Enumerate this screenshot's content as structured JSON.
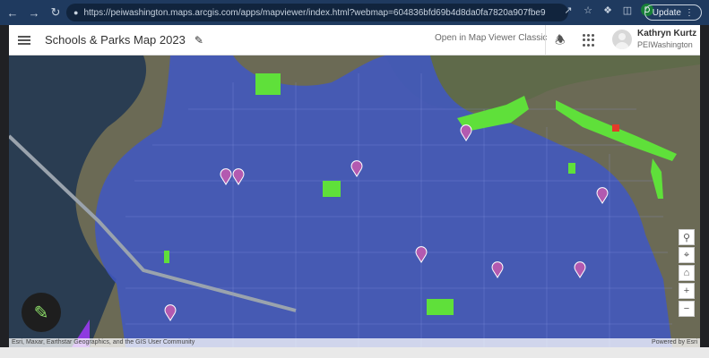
{
  "browser": {
    "url": "https://peiwashington.maps.arcgis.com/apps/mapviewer/index.html?webmap=604836bfd69b4d8da0fa7820a907fbe9",
    "profile_initial": "D",
    "update_label": "Update"
  },
  "header": {
    "title": "Schools & Parks Map 2023",
    "classic_link": "Open in Map Viewer Classic",
    "user_name": "Kathryn Kurtz",
    "user_org": "PEIWashington"
  },
  "map": {
    "attribution": "Esri, Maxar, Earthstar Geographics, and the GIS User Community",
    "powered_by": "Powered by Esri",
    "colors": {
      "water": "#2a3d52",
      "land": "#6b6a55",
      "district_fill": "#3f57c4",
      "park": "#5fe03a",
      "school_marker": "#b35ab0"
    }
  },
  "icons": {
    "back": "arrow-left-icon",
    "forward": "arrow-right-icon",
    "reload": "reload-icon",
    "lock": "lock-icon",
    "menu": "hamburger-icon",
    "edit": "pencil-icon",
    "bell": "bell-icon",
    "apps": "apps-grid-icon"
  }
}
